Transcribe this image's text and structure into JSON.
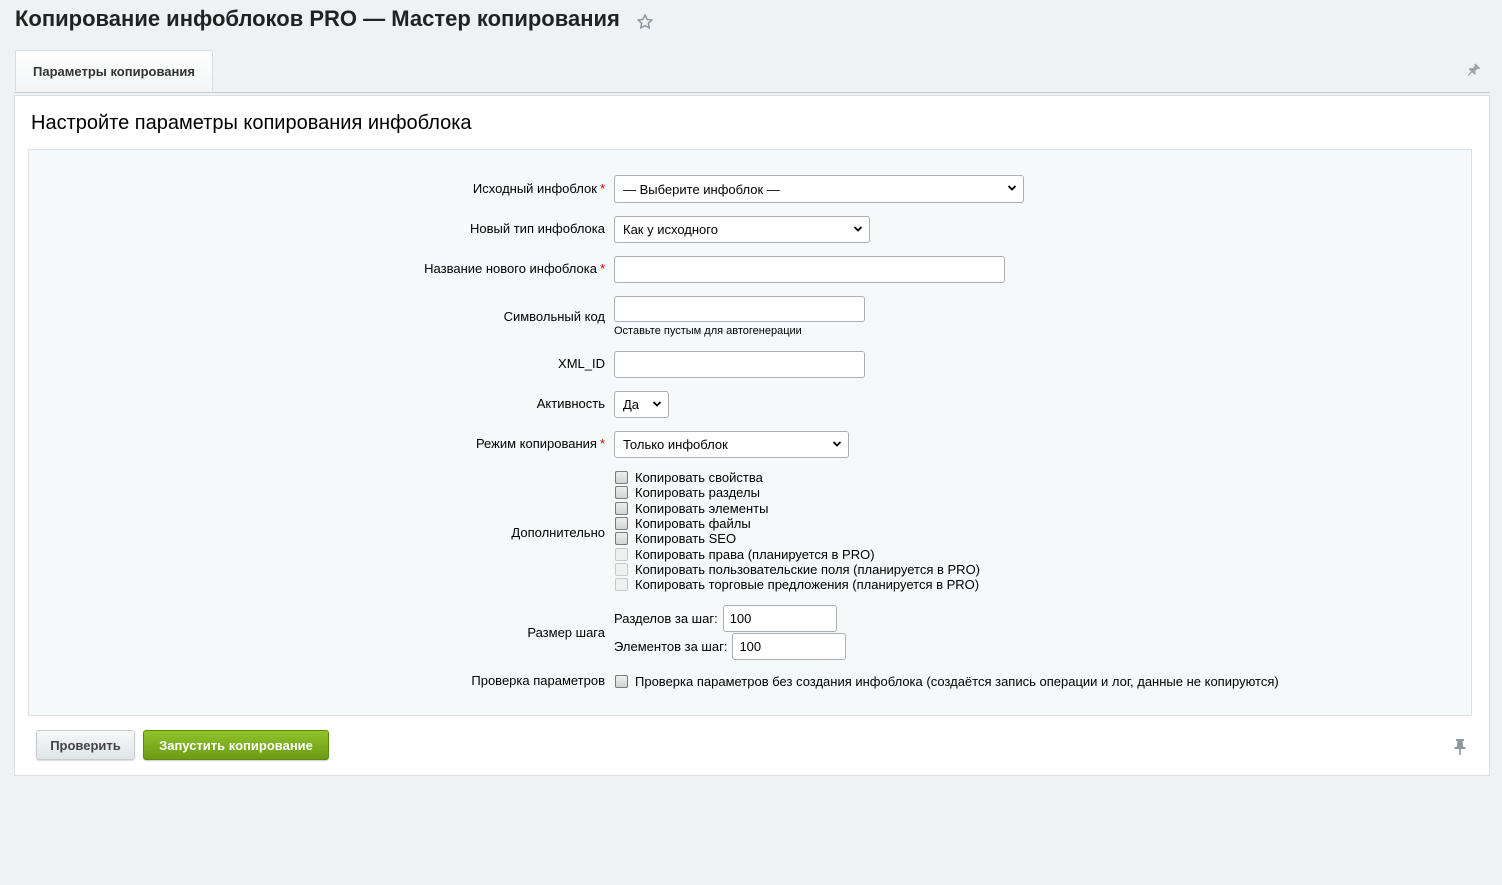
{
  "header": {
    "title": "Копирование инфоблоков PRO — Мастер копирования"
  },
  "tabs": [
    {
      "label": "Параметры копирования"
    }
  ],
  "panel": {
    "heading": "Настройте параметры копирования инфоблока"
  },
  "form": {
    "source_iblock": {
      "label": "Исходный инфоблок",
      "value": "— Выберите инфоблок —"
    },
    "new_type": {
      "label": "Новый тип инфоблока",
      "value": "Как у исходного"
    },
    "new_name": {
      "label": "Название нового инфоблока",
      "value": ""
    },
    "code": {
      "label": "Символьный код",
      "value": "",
      "hint": "Оставьте пустым для автогенерации"
    },
    "xml_id": {
      "label": "XML_ID",
      "value": ""
    },
    "active": {
      "label": "Активность",
      "value": "Да"
    },
    "mode": {
      "label": "Режим копирования",
      "value": "Только инфоблок"
    },
    "extra": {
      "label": "Дополнительно",
      "options": [
        "Копировать свойства",
        "Копировать разделы",
        "Копировать элементы",
        "Копировать файлы",
        "Копировать SEO",
        "Копировать права (планируется в PRO)",
        "Копировать пользовательские поля (планируется в PRO)",
        "Копировать торговые предложения (планируется в PRO)"
      ]
    },
    "step": {
      "label": "Размер шага",
      "sections_label": "Разделов за шаг:",
      "sections_value": "100",
      "elements_label": "Элементов за шаг:",
      "elements_value": "100"
    },
    "check": {
      "label": "Проверка параметров",
      "option": "Проверка параметров без создания инфоблока (создаётся запись операции и лог, данные не копируются)"
    }
  },
  "buttons": {
    "check": "Проверить",
    "run": "Запустить копирование"
  }
}
